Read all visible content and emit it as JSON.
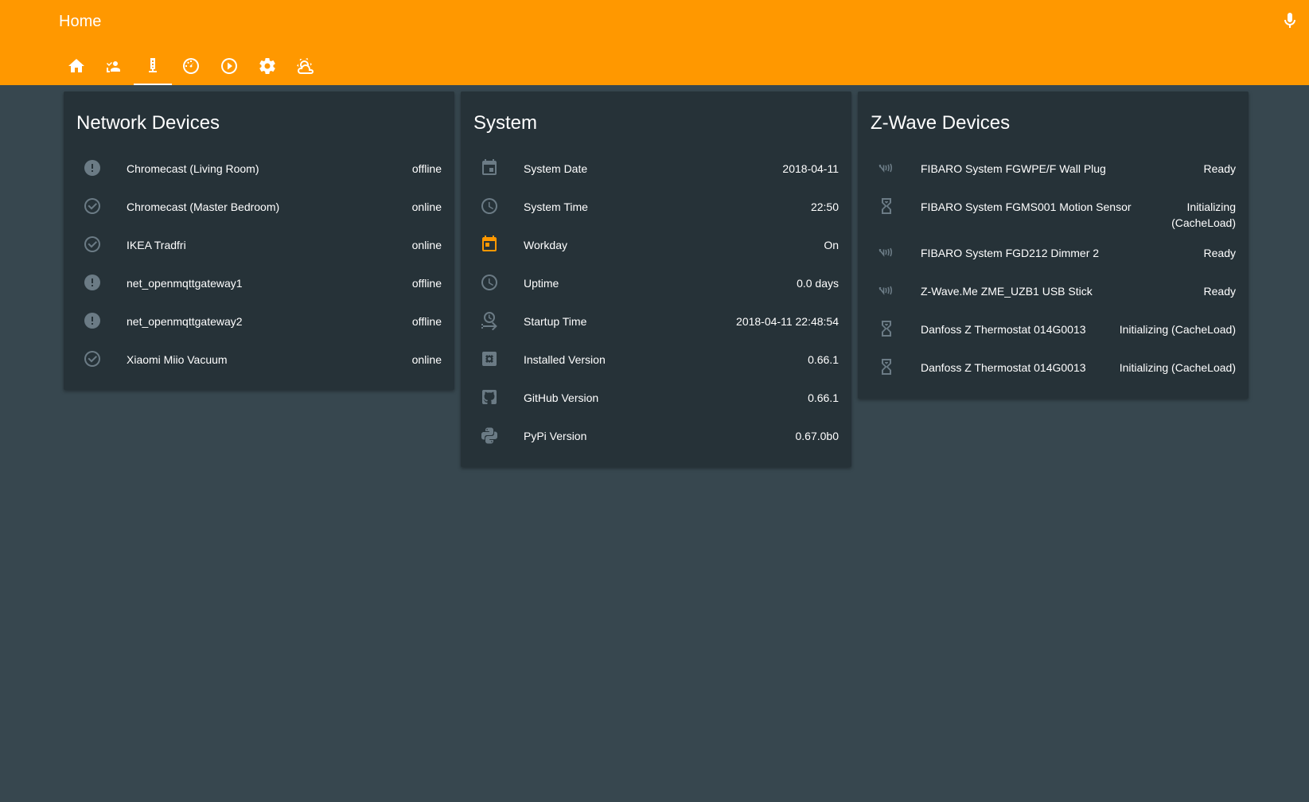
{
  "header": {
    "title": "Home",
    "mic_icon": "microphone-icon",
    "tabs": [
      {
        "icon": "home-icon",
        "active": false
      },
      {
        "icon": "account-location-icon",
        "active": false
      },
      {
        "icon": "server-network-icon",
        "active": true
      },
      {
        "icon": "speedometer-icon",
        "active": false
      },
      {
        "icon": "play-circle-icon",
        "active": false
      },
      {
        "icon": "settings-icon",
        "active": false
      },
      {
        "icon": "weather-partlycloudy-icon",
        "active": false
      }
    ],
    "colors": {
      "background": "#ff9800",
      "text": "#ffffff"
    }
  },
  "network": {
    "title": "Network Devices",
    "items": [
      {
        "label": "Chromecast (Living Room)",
        "value": "offline",
        "icon": "alert-circle-icon"
      },
      {
        "label": "Chromecast (Master Bedroom)",
        "value": "online",
        "icon": "check-circle-outline-icon"
      },
      {
        "label": "IKEA Tradfri",
        "value": "online",
        "icon": "check-circle-outline-icon"
      },
      {
        "label": "net_openmqttgateway1",
        "value": "offline",
        "icon": "alert-circle-icon"
      },
      {
        "label": "net_openmqttgateway2",
        "value": "offline",
        "icon": "alert-circle-icon"
      },
      {
        "label": "Xiaomi Miio Vacuum",
        "value": "online",
        "icon": "check-circle-outline-icon"
      }
    ]
  },
  "system": {
    "title": "System",
    "items": [
      {
        "label": "System Date",
        "value": "2018-04-11",
        "icon": "calendar-icon"
      },
      {
        "label": "System Time",
        "value": "22:50",
        "icon": "clock-icon"
      },
      {
        "label": "Workday",
        "value": "On",
        "icon": "calendar-today-icon",
        "accent": true
      },
      {
        "label": "Uptime",
        "value": "0.0 days",
        "icon": "clock-icon"
      },
      {
        "label": "Startup Time",
        "value": "2018-04-11 22:48:54",
        "icon": "clock-start-icon"
      },
      {
        "label": "Installed Version",
        "value": "0.66.1",
        "icon": "package-icon"
      },
      {
        "label": "GitHub Version",
        "value": "0.66.1",
        "icon": "github-icon"
      },
      {
        "label": "PyPi Version",
        "value": "0.67.0b0",
        "icon": "python-icon"
      }
    ]
  },
  "zwave": {
    "title": "Z-Wave Devices",
    "items": [
      {
        "label": "FIBARO System FGWPE/F Wall Plug",
        "value": "Ready",
        "icon": "z-wave-icon"
      },
      {
        "label": "FIBARO System FGMS001 Motion Sensor",
        "value": "Initializing (CacheLoad)",
        "icon": "hourglass-icon",
        "wrap": true
      },
      {
        "label": "FIBARO System FGD212 Dimmer 2",
        "value": "Ready",
        "icon": "z-wave-icon"
      },
      {
        "label": "Z-Wave.Me ZME_UZB1 USB Stick",
        "value": "Ready",
        "icon": "z-wave-icon"
      },
      {
        "label": "Danfoss Z Thermostat 014G0013",
        "value": "Initializing (CacheLoad)",
        "icon": "hourglass-icon"
      },
      {
        "label": "Danfoss Z Thermostat 014G0013",
        "value": "Initializing (CacheLoad)",
        "icon": "hourglass-icon"
      }
    ]
  },
  "colors": {
    "page_background": "#37474f",
    "card_background": "#263238",
    "icon_gray": "#6b7b85",
    "accent": "#ff9800"
  }
}
